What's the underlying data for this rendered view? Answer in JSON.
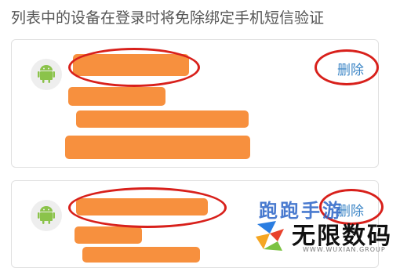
{
  "header": {
    "intro_text": "列表中的设备在登录时将免除绑定手机短信验证"
  },
  "devices": [
    {
      "os_icon": "android-icon",
      "delete_label": "删除"
    },
    {
      "os_icon": "android-icon",
      "delete_label": "删除"
    }
  ],
  "colors": {
    "redaction": "#f7903e",
    "annotation_ring": "#d8201b",
    "delete_link": "#3d86c6",
    "android_green": "#8bc34a"
  },
  "watermark": {
    "top_text": "跑跑手游",
    "brand": "无限数码",
    "domain": "WWW.WUXIAN.GROUP"
  }
}
